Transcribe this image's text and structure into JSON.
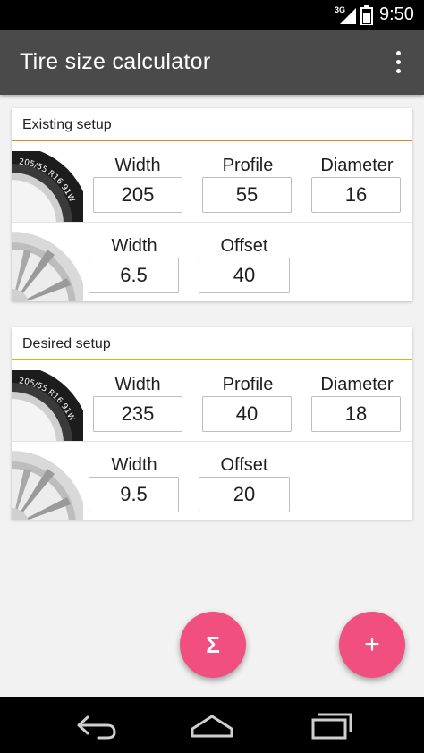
{
  "status_bar": {
    "network": "3G",
    "time": "9:50"
  },
  "app_bar": {
    "title": "Tire size calculator",
    "overflow_icon": "more-vert-icon"
  },
  "existing_setup": {
    "title": "Existing setup",
    "accent_color": "#e8861a",
    "tire": {
      "width_label": "Width",
      "width_value": "205",
      "profile_label": "Profile",
      "profile_value": "55",
      "diameter_label": "Diameter",
      "diameter_value": "16"
    },
    "rim": {
      "width_label": "Width",
      "width_value": "6.5",
      "offset_label": "Offset",
      "offset_value": "40"
    }
  },
  "desired_setup": {
    "title": "Desired setup",
    "accent_color": "#bcc21a",
    "tire": {
      "width_label": "Width",
      "width_value": "235",
      "profile_label": "Profile",
      "profile_value": "40",
      "diameter_label": "Diameter",
      "diameter_value": "18"
    },
    "rim": {
      "width_label": "Width",
      "width_value": "9.5",
      "offset_label": "Offset",
      "offset_value": "20"
    }
  },
  "tire_sidewall_text": "205/55 R16 91W",
  "actions": {
    "calculate_icon": "Σ",
    "add_icon": "+",
    "fab_color": "#f04f7f"
  },
  "nav_bar": {
    "back_icon": "back-icon",
    "home_icon": "home-icon",
    "recents_icon": "recents-icon"
  }
}
